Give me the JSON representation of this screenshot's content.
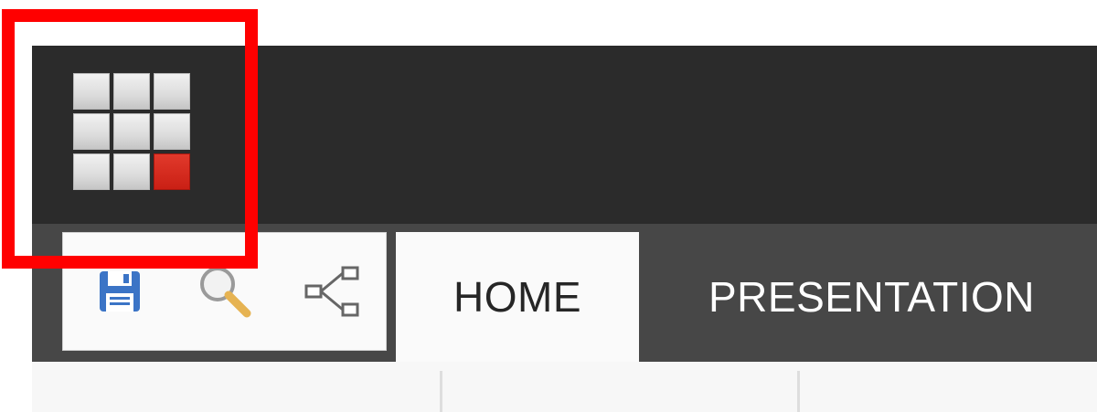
{
  "header": {
    "app_launcher_icon": "app-launcher-grid-icon",
    "accent_color": "#d62b20"
  },
  "annotation": {
    "highlight_color": "#ff0000"
  },
  "quick_access": {
    "items": [
      {
        "icon": "save-icon",
        "color": "#3b74c6"
      },
      {
        "icon": "search-icon",
        "color": "#e6b352"
      },
      {
        "icon": "share-icon",
        "color": "#666666"
      }
    ]
  },
  "tabs": [
    {
      "label": "HOME",
      "active": true
    },
    {
      "label": "PRESENTATION",
      "active": false
    }
  ]
}
